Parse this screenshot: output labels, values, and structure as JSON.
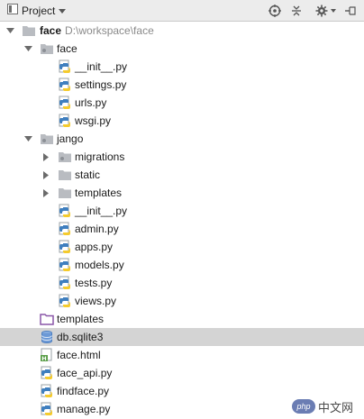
{
  "toolbar": {
    "project_label": "Project",
    "icons": [
      "project-window-icon",
      "chevron-down-icon",
      "target-icon",
      "collapse-icon",
      "gear-icon",
      "hide-icon"
    ]
  },
  "tree": {
    "root": {
      "name": "face",
      "path": "D:\\workspace\\face"
    },
    "face_pkg": {
      "name": "face",
      "files": [
        "__init__.py",
        "settings.py",
        "urls.py",
        "wsgi.py"
      ]
    },
    "jango_pkg": {
      "name": "jango",
      "folders": [
        "migrations",
        "static",
        "templates"
      ],
      "files": [
        "__init__.py",
        "admin.py",
        "apps.py",
        "models.py",
        "tests.py",
        "views.py"
      ]
    },
    "root_items": [
      {
        "name": "templates",
        "kind": "templates-folder"
      },
      {
        "name": "db.sqlite3",
        "kind": "database"
      },
      {
        "name": "face.html",
        "kind": "html"
      },
      {
        "name": "face_api.py",
        "kind": "python"
      },
      {
        "name": "findface.py",
        "kind": "python"
      },
      {
        "name": "manage.py",
        "kind": "python"
      }
    ],
    "selected": "db.sqlite3"
  },
  "watermark": {
    "badge": "php",
    "text": "中文网"
  },
  "colors": {
    "toolbar_bg": "#ececec",
    "selection": "#d4d4d4",
    "folder": "#b9bcc1",
    "python_blue": "#3f7fbf",
    "python_yellow": "#f5cb2c",
    "templates_folder": "#8a57a8",
    "db_blue": "#6c99d6",
    "html_green": "#5a9e48"
  }
}
